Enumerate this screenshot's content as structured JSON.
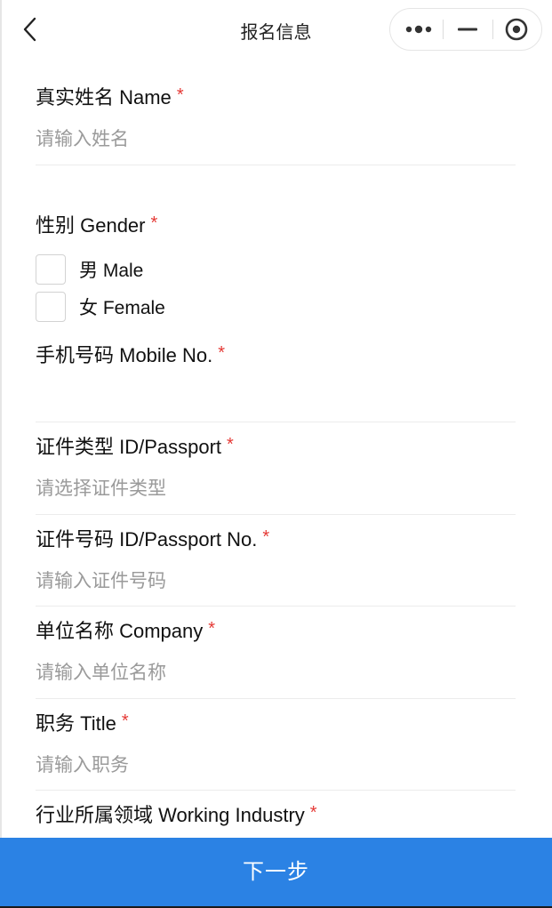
{
  "header": {
    "title": "报名信息"
  },
  "form": {
    "name": {
      "label": "真实姓名 Name",
      "required_mark": "*",
      "placeholder": "请输入姓名",
      "value": ""
    },
    "gender": {
      "label": "性别 Gender",
      "required_mark": "*",
      "options": [
        {
          "label": "男 Male",
          "checked": false
        },
        {
          "label": "女 Female",
          "checked": false
        }
      ]
    },
    "mobile": {
      "label": "手机号码 Mobile No.",
      "required_mark": "*",
      "placeholder": "",
      "value": ""
    },
    "id_type": {
      "label": "证件类型 ID/Passport",
      "required_mark": "*",
      "placeholder": "请选择证件类型",
      "value": ""
    },
    "id_number": {
      "label": "证件号码 ID/Passport No.",
      "required_mark": "*",
      "placeholder": "请输入证件号码",
      "value": ""
    },
    "company": {
      "label": "单位名称 Company",
      "required_mark": "*",
      "placeholder": "请输入单位名称",
      "value": ""
    },
    "title": {
      "label": "职务 Title",
      "required_mark": "*",
      "placeholder": "请输入职务",
      "value": ""
    },
    "industry": {
      "label": "行业所属领域 Working Industry",
      "required_mark": "*"
    }
  },
  "footer": {
    "next_label": "下一步"
  },
  "colors": {
    "primary": "#2b82e4",
    "required": "#e53935",
    "placeholder": "#9a9a9a",
    "divider": "#ececec"
  }
}
